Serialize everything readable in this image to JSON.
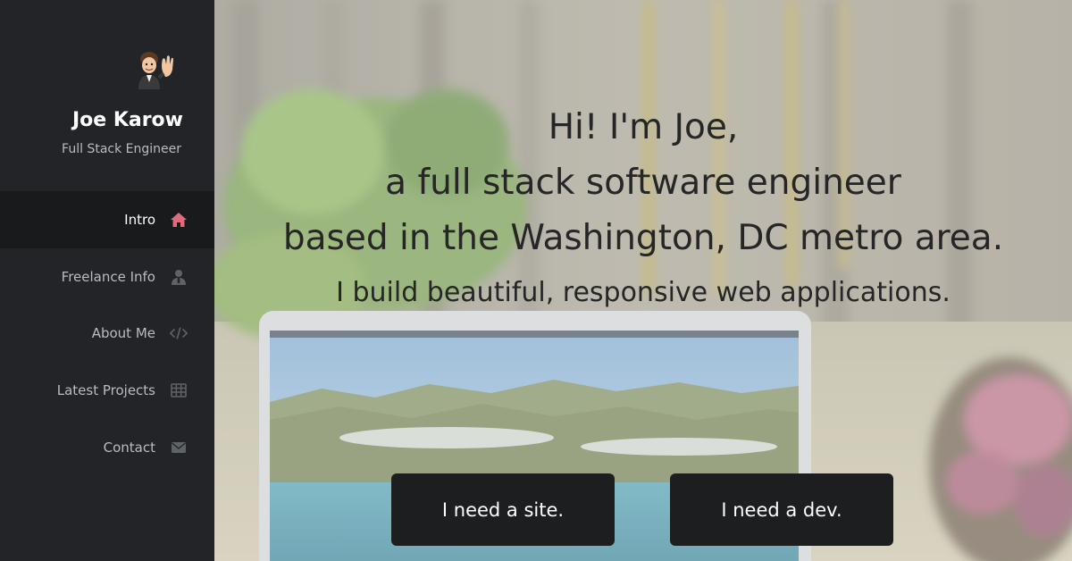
{
  "profile": {
    "name": "Joe Karow",
    "role": "Full Stack Engineer"
  },
  "nav": {
    "items": [
      {
        "label": "Intro",
        "icon": "home-icon",
        "active": true
      },
      {
        "label": "Freelance Info",
        "icon": "user-tie-icon",
        "active": false
      },
      {
        "label": "About Me",
        "icon": "code-icon",
        "active": false
      },
      {
        "label": "Latest Projects",
        "icon": "grid-icon",
        "active": false
      },
      {
        "label": "Contact",
        "icon": "envelope-icon",
        "active": false
      }
    ]
  },
  "hero": {
    "line1": "Hi! I'm Joe,",
    "line2": "a full stack software engineer",
    "line3": "based in the Washington, DC metro area.",
    "tagline": "I build beautiful, responsive web applications.",
    "button_site": "I need a site.",
    "button_dev": "I need a dev."
  },
  "colors": {
    "sidebar_bg": "#222427",
    "active_bg": "#191a1c",
    "accent": "#e06b7a",
    "button_bg": "#1d1e20"
  }
}
